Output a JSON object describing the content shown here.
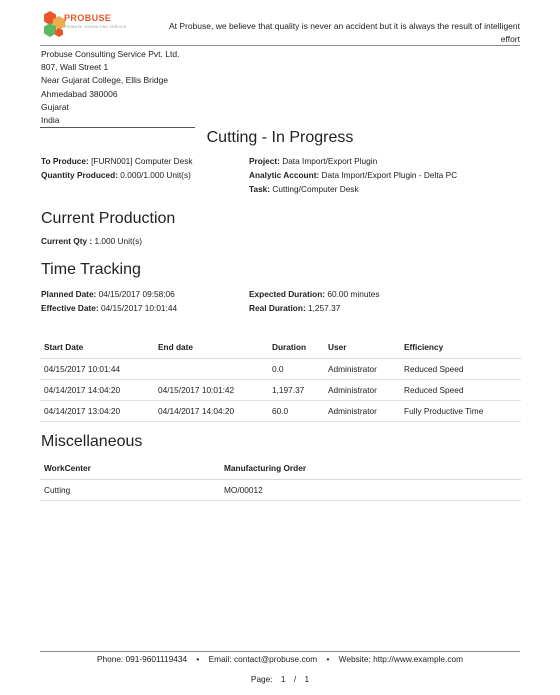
{
  "header": {
    "brand": "PROBUSE",
    "brand_sub": "PROBUSE CONSULTING SERVICE",
    "tagline": "At Probuse, we believe that quality is never an accident but it is always the result of intelligent effort"
  },
  "company": {
    "name": "Probuse Consulting Service Pvt. Ltd.",
    "street": "807, Wall Street 1",
    "street2": "Near Gujarat College, Ellis Bridge",
    "city": "Ahmedabad 380006",
    "state": "Gujarat",
    "country": "India"
  },
  "title": "Cutting - In Progress",
  "info": {
    "to_produce_label": "To Produce:",
    "to_produce": "[FURN001] Computer Desk",
    "qty_produced_label": "Quantity Produced:",
    "qty_produced": "0.000/1.000 Unit(s)",
    "project_label": "Project:",
    "project": "Data Import/Export Plugin",
    "analytic_label": "Analytic Account:",
    "analytic": "Data Import/Export Plugin - Delta PC",
    "task_label": "Task:",
    "task": "Cutting/Computer Desk"
  },
  "current_production": {
    "heading": "Current Production",
    "qty_label": "Current Qty :",
    "qty": "1.000 Unit(s)"
  },
  "time_tracking": {
    "heading": "Time Tracking",
    "planned_label": "Planned Date:",
    "planned": "04/15/2017 09:58:06",
    "effective_label": "Effective Date:",
    "effective": "04/15/2017 10:01:44",
    "expected_label": "Expected Duration:",
    "expected": "60.00 minutes",
    "real_label": "Real Duration:",
    "real": "1,257.37",
    "columns": [
      "Start Date",
      "End date",
      "Duration",
      "User",
      "Efficiency"
    ],
    "rows": [
      [
        "04/15/2017 10:01:44",
        "",
        "0.0",
        "Administrator",
        "Reduced Speed"
      ],
      [
        "04/14/2017 14:04:20",
        "04/15/2017 10:01:42",
        "1,197.37",
        "Administrator",
        "Reduced Speed"
      ],
      [
        "04/14/2017 13:04:20",
        "04/14/2017 14:04:20",
        "60.0",
        "Administrator",
        "Fully Productive Time"
      ]
    ]
  },
  "misc": {
    "heading": "Miscellaneous",
    "columns": [
      "WorkCenter",
      "Manufacturing Order"
    ],
    "rows": [
      [
        "Cutting",
        "MO/00012"
      ]
    ]
  },
  "footer": {
    "phone": "Phone: 091-9601119434",
    "email": "Email: contact@probuse.com",
    "website": "Website: http://www.example.com",
    "sep": "•",
    "page_label": "Page:",
    "page_current": "1",
    "page_sep": "/",
    "page_total": "1"
  },
  "colors": {
    "logo_orange": "#e8562a",
    "logo_green": "#5cb85c",
    "logo_yellow": "#f0ad4e",
    "rule": "#8a8a8a"
  }
}
